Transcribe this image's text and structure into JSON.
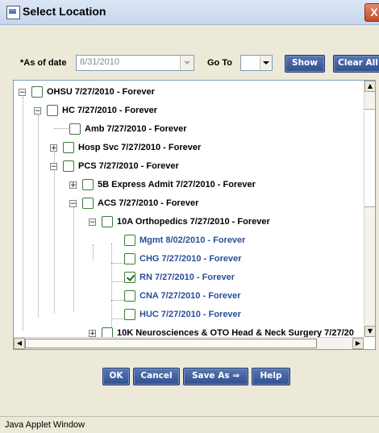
{
  "window": {
    "title": "Select Location",
    "close_glyph": "X"
  },
  "filters": {
    "as_of_label": "*As of date",
    "as_of_value": "8/31/2010",
    "goto_label": "Go To",
    "show_button": "Show",
    "clear_all_button": "Clear All"
  },
  "tree": [
    {
      "label": "OHSU  7/27/2010 - Forever",
      "expanded": true,
      "checked": false,
      "blue": false
    },
    {
      "label": "HC  7/27/2010 - Forever",
      "expanded": true,
      "checked": false,
      "blue": false
    },
    {
      "label": "Amb  7/27/2010 - Forever",
      "expanded": null,
      "checked": false,
      "blue": false
    },
    {
      "label": "Hosp Svc  7/27/2010 - Forever",
      "expanded": false,
      "checked": false,
      "blue": false
    },
    {
      "label": "PCS  7/27/2010 - Forever",
      "expanded": true,
      "checked": false,
      "blue": false
    },
    {
      "label": "5B Express Admit  7/27/2010 - Forever",
      "expanded": false,
      "checked": false,
      "blue": false
    },
    {
      "label": "ACS  7/27/2010 - Forever",
      "expanded": true,
      "checked": false,
      "blue": false
    },
    {
      "label": "10A Orthopedics  7/27/2010 - Forever",
      "expanded": true,
      "checked": false,
      "blue": false
    },
    {
      "label": "Mgmt  8/02/2010 - Forever",
      "expanded": null,
      "checked": false,
      "blue": true
    },
    {
      "label": "CHG  7/27/2010 - Forever",
      "expanded": null,
      "checked": false,
      "blue": true
    },
    {
      "label": "RN  7/27/2010 - Forever",
      "expanded": null,
      "checked": true,
      "blue": true
    },
    {
      "label": "CNA  7/27/2010 - Forever",
      "expanded": null,
      "checked": false,
      "blue": true
    },
    {
      "label": "HUC  7/27/2010 - Forever",
      "expanded": null,
      "checked": false,
      "blue": true
    },
    {
      "label": "10K Neurosciences & OTO Head & Neck Surgery  7/27/20",
      "expanded": false,
      "checked": false,
      "blue": false
    }
  ],
  "buttons": {
    "ok": "OK",
    "cancel": "Cancel",
    "save_as": "Save As ⇒",
    "help": "Help"
  },
  "status": {
    "text": "Java Applet Window"
  }
}
